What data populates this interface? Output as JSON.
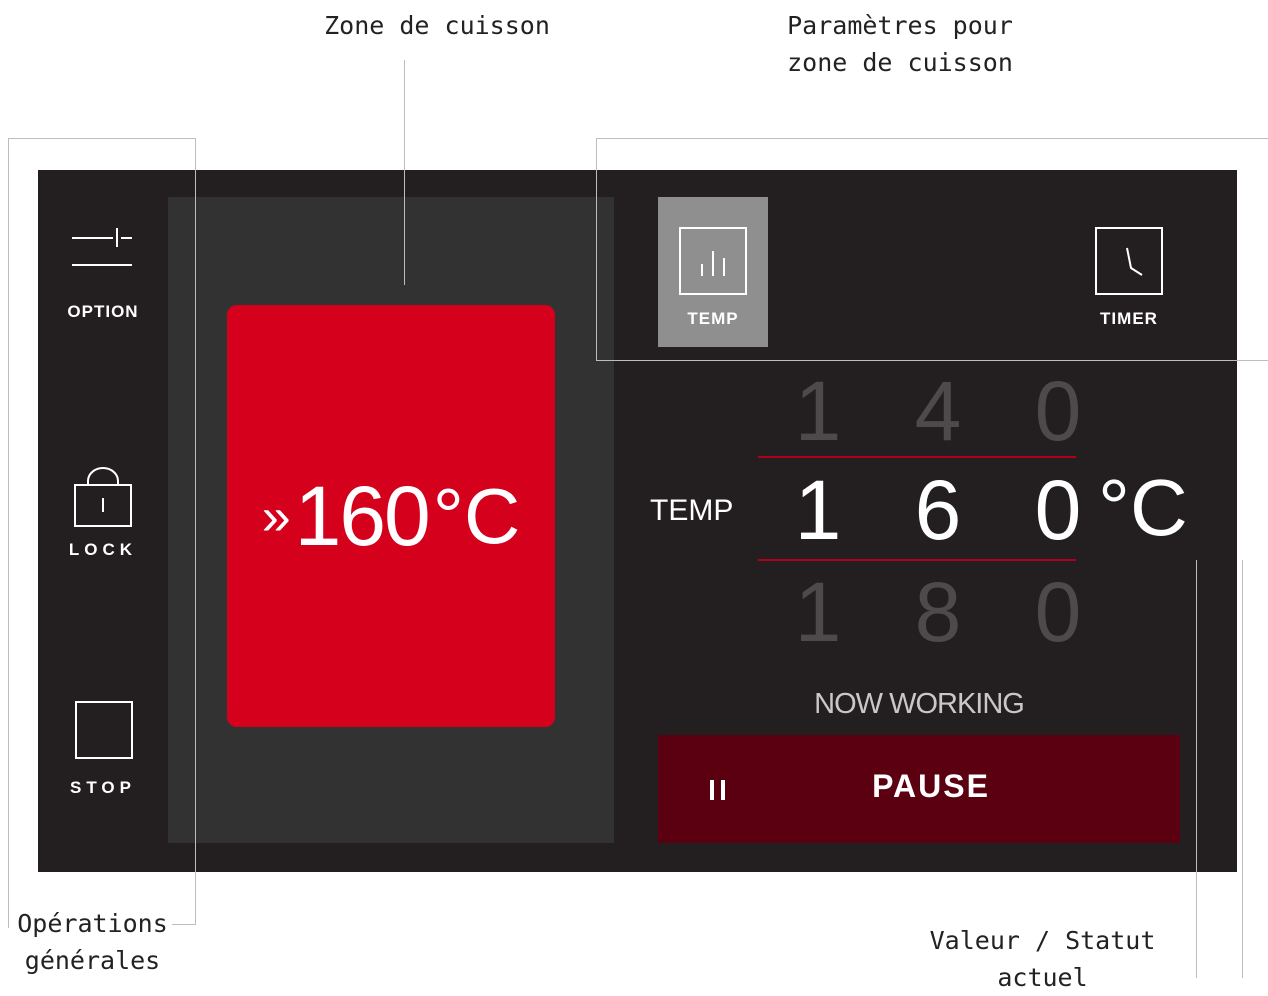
{
  "annotations": {
    "cooking_zone": "Zone de cuisson",
    "zone_settings": "Paramètres pour\nzone de cuisson",
    "general_operations": "Opérations\ngénérales",
    "current_value_status": "Valeur / Statut\nactuel"
  },
  "sidebar": {
    "option_label": "OPTION",
    "lock_label": "LOCK",
    "stop_label": "STOP"
  },
  "zone_card": {
    "temperature": "160",
    "unit": "°C",
    "state_icon": "double-chevron-right"
  },
  "tabs": {
    "temp_label": "TEMP",
    "temp_active": true,
    "timer_label": "TIMER"
  },
  "temp_picker": {
    "label": "TEMP",
    "unit": "°C",
    "previous": [
      "1",
      "4",
      "0"
    ],
    "current": [
      "1",
      "6",
      "0"
    ],
    "next": [
      "1",
      "8",
      "0"
    ]
  },
  "status": {
    "text": "NOW WORKING",
    "pause_label": "PAUSE",
    "pause_icon": "pause-icon"
  },
  "colors": {
    "panel_bg": "#231f20",
    "zone_bg": "#333233",
    "accent_red": "#d5001c",
    "pause_bg": "#5b0010",
    "active_tab_bg": "#8f8f8f"
  }
}
